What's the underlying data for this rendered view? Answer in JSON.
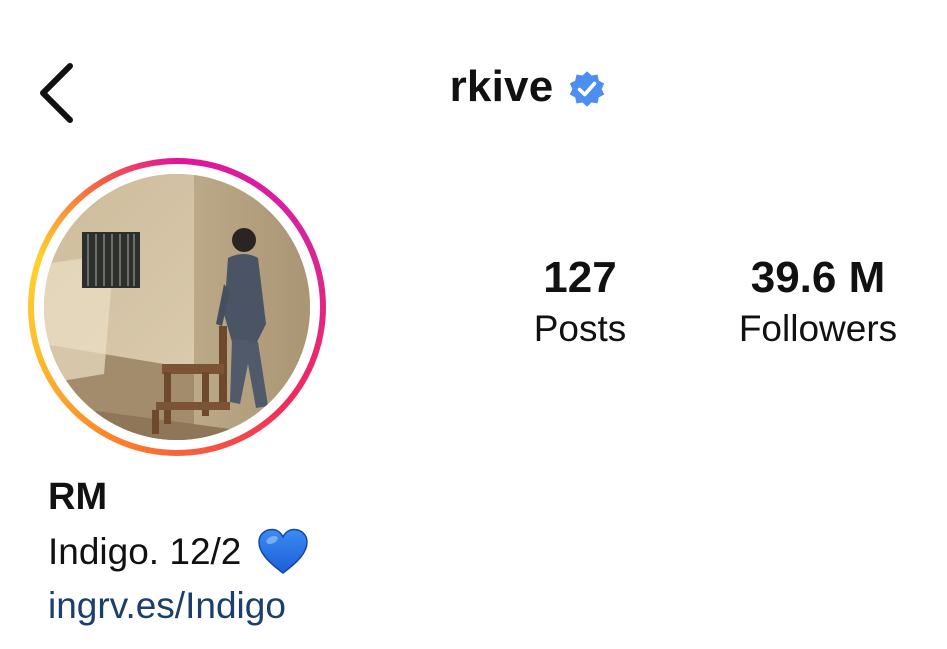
{
  "header": {
    "username": "rkive",
    "verified": true,
    "back_icon": "chevron-left-icon",
    "verified_icon": "verified-badge-icon",
    "verified_color": "#4d8ff0"
  },
  "profile": {
    "display_name": "RM",
    "bio": "Indigo. 12/2",
    "bio_emoji": "blue-heart-icon",
    "link": "ingrv.es/Indigo",
    "link_color": "#1a3f6b",
    "avatar_has_story_ring": true
  },
  "stats": {
    "posts": {
      "value": "127",
      "label": "Posts"
    },
    "followers": {
      "value": "39.6 M",
      "label": "Followers"
    }
  }
}
